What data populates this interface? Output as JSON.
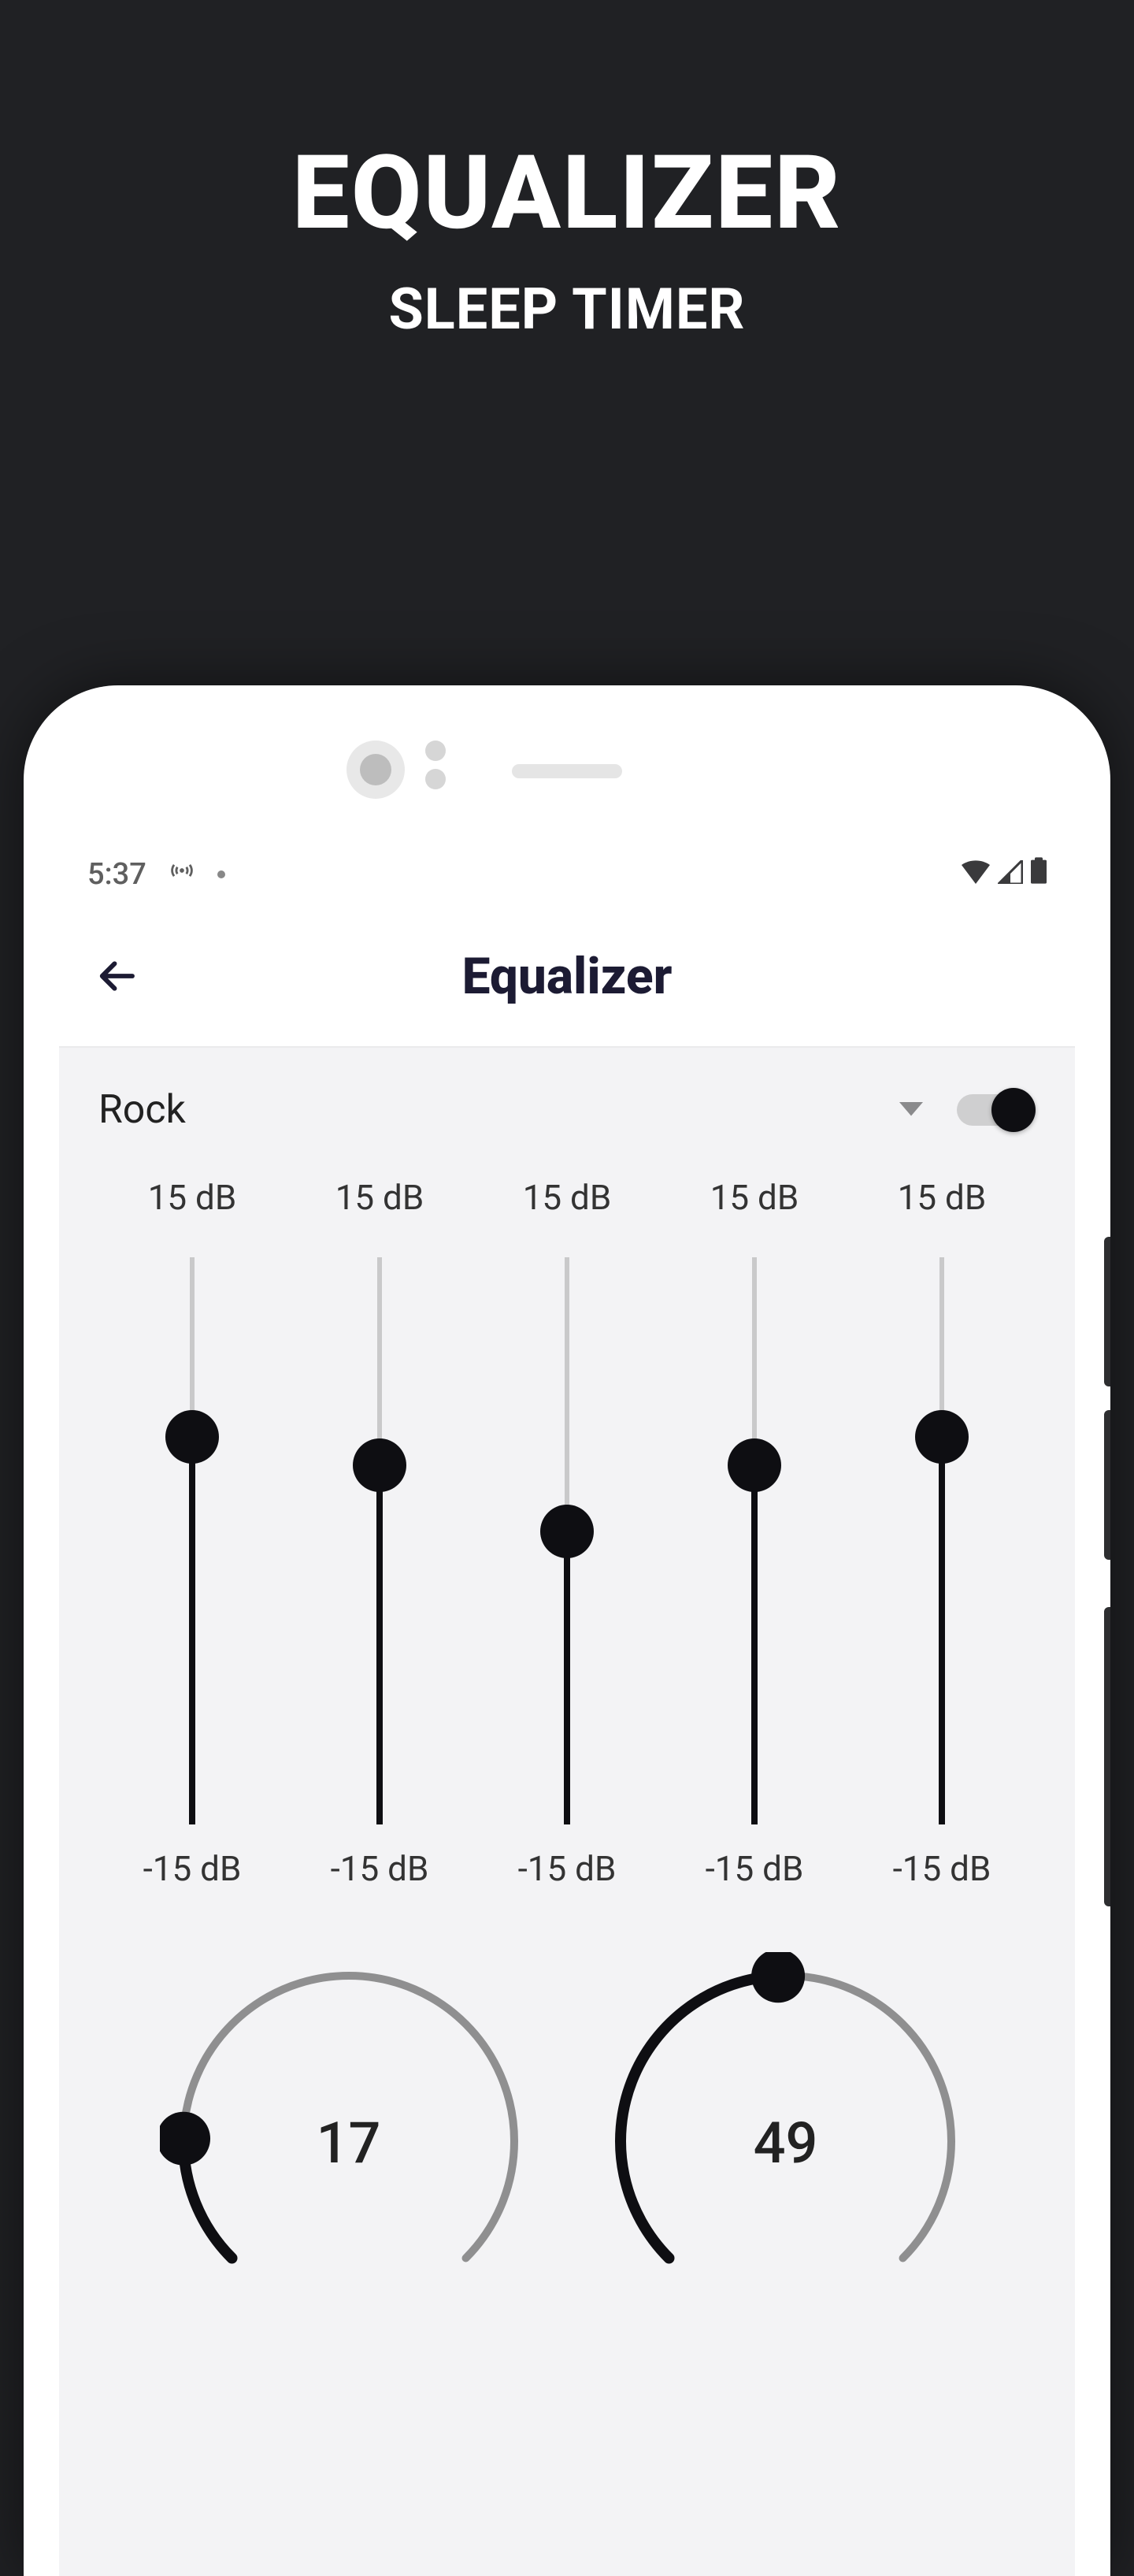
{
  "promo": {
    "title": "EQUALIZER",
    "subtitle": "SLEEP TIMER"
  },
  "status": {
    "time": "5:37",
    "broadcast_icon": "broadcast-icon",
    "wifi_icon": "wifi-icon",
    "cell_icon": "cell-icon",
    "battery_icon": "battery-icon"
  },
  "header": {
    "title": "Equalizer"
  },
  "preset": {
    "name": "Rock",
    "enabled": true
  },
  "bands": {
    "top_db": "15 dB",
    "bottom_db": "-15 dB",
    "values": [
      5.5,
      4.0,
      0.5,
      4.0,
      5.5
    ]
  },
  "dials": {
    "left": {
      "value": "17",
      "percent": 17
    },
    "right": {
      "value": "49",
      "percent": 49
    }
  }
}
